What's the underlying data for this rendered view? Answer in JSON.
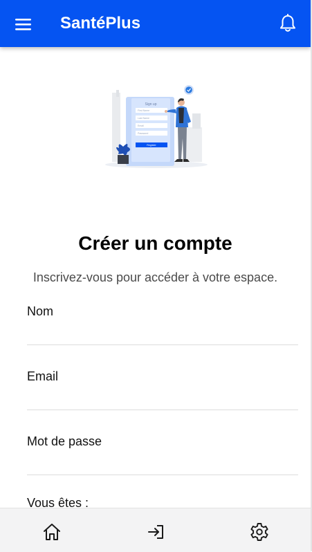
{
  "app_bar": {
    "title": "SantéPlus",
    "menu_icon": "menu-icon",
    "notification_icon": "bell-icon",
    "background_color": "#0554f2"
  },
  "illustration": {
    "form_title": "Sign up",
    "fields": [
      "First Name",
      "Last Name",
      "Email",
      "Password"
    ],
    "button_label": "Register"
  },
  "register": {
    "heading": "Créer un compte",
    "subtitle": "Inscrivez-vous pour accéder à votre espace.",
    "fields": {
      "name_label": "Nom",
      "email_label": "Email",
      "password_label": "Mot de passe"
    },
    "role_label": "Vous êtes :"
  },
  "bottom_nav": {
    "items": [
      {
        "icon": "home-icon"
      },
      {
        "icon": "login-icon"
      },
      {
        "icon": "settings-icon"
      }
    ]
  }
}
